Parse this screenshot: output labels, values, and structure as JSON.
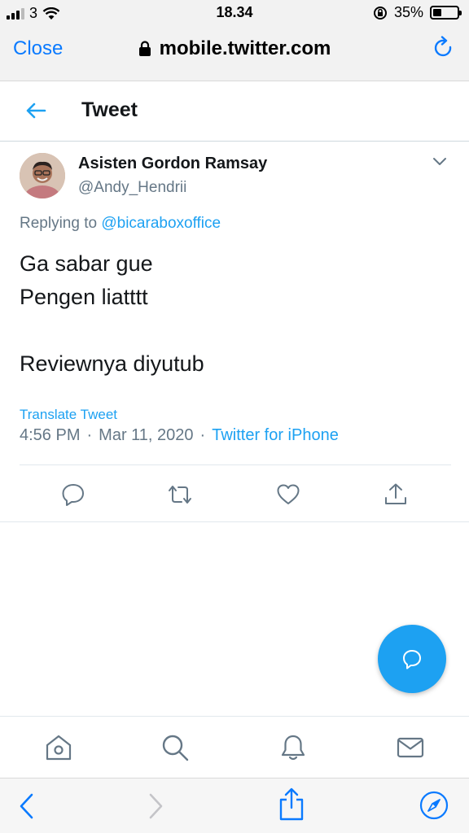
{
  "status": {
    "carrier": "3",
    "time": "18.34",
    "battery": "35%"
  },
  "browser": {
    "close_label": "Close",
    "url": "mobile.twitter.com"
  },
  "header": {
    "title": "Tweet"
  },
  "tweet": {
    "display_name": "Asisten Gordon Ramsay",
    "handle": "@Andy_Hendrii",
    "replying_prefix": "Replying to",
    "replying_to": "@bicaraboxoffice",
    "text": "Ga sabar gue\nPengen liatttt\n\nReviewnya diyutub",
    "translate_label": "Translate Tweet",
    "time": "4:56 PM",
    "date": "Mar 11, 2020",
    "source": "Twitter for iPhone",
    "separator": "·"
  },
  "colors": {
    "twitter_blue": "#1da1f2",
    "ios_blue": "#0a7aff",
    "secondary_text": "#657786"
  }
}
